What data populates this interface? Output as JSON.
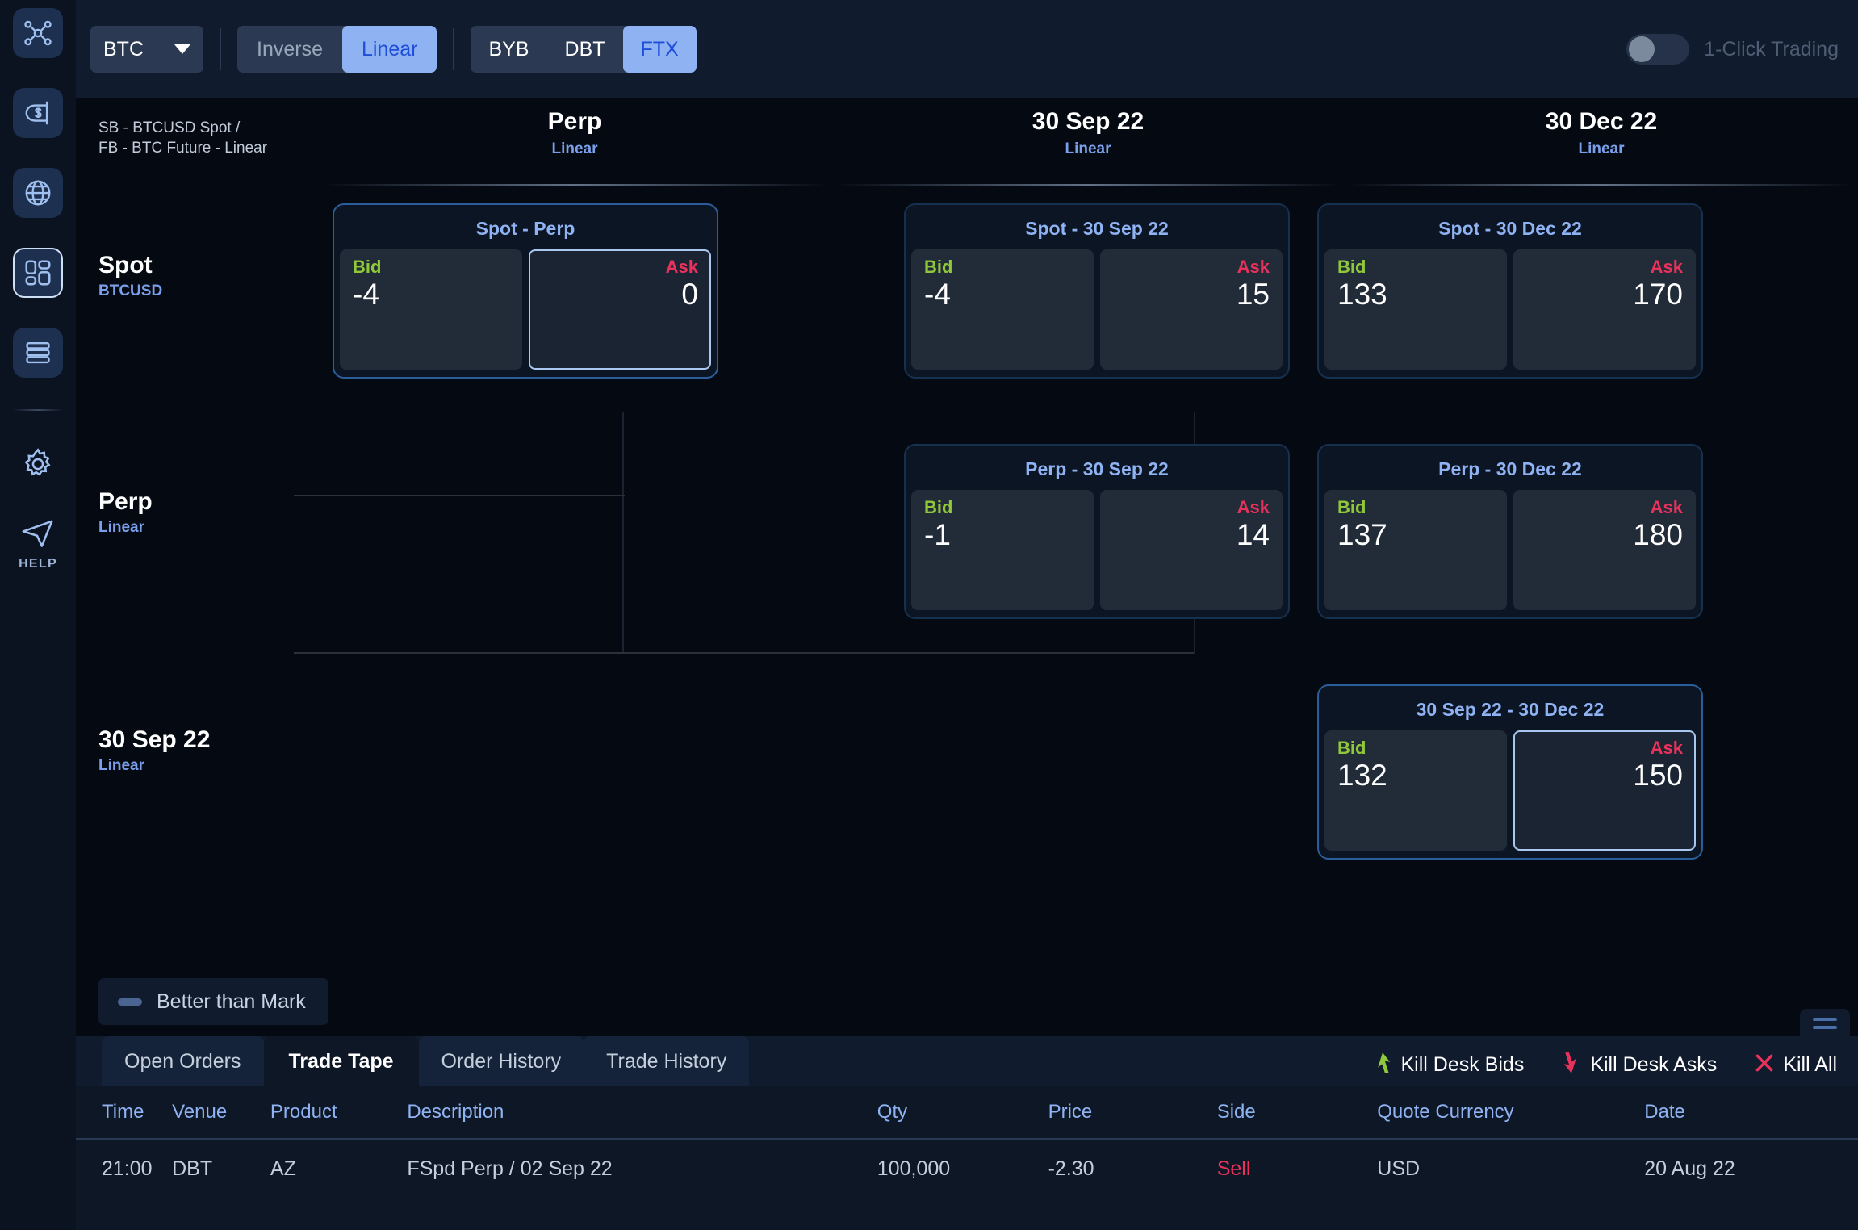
{
  "rail": {
    "items": [
      {
        "name": "network-icon",
        "label": ""
      },
      {
        "name": "dollar-flag-icon",
        "label": ""
      },
      {
        "name": "globe-icon",
        "label": ""
      },
      {
        "name": "dashboard-icon",
        "label": ""
      },
      {
        "name": "list-icon",
        "label": ""
      },
      {
        "name": "gear-icon",
        "label": ""
      },
      {
        "name": "help-icon",
        "label": "HELP"
      }
    ],
    "help_label": "HELP"
  },
  "toolbar": {
    "asset": "BTC",
    "asset_options": [
      "BTC"
    ],
    "contract_types": [
      {
        "label": "Inverse",
        "active": false
      },
      {
        "label": "Linear",
        "active": true
      }
    ],
    "venues": [
      {
        "label": "BYB",
        "active": false
      },
      {
        "label": "DBT",
        "active": false
      },
      {
        "label": "FTX",
        "active": true
      }
    ],
    "one_click_label": "1-Click Trading",
    "one_click_on": false
  },
  "matrix": {
    "corner_line1": "SB - BTCUSD Spot /",
    "corner_line2": "FB - BTC Future - Linear",
    "columns": [
      {
        "title": "Perp",
        "sub": "Linear"
      },
      {
        "title": "30 Sep 22",
        "sub": "Linear"
      },
      {
        "title": "30 Dec 22",
        "sub": "Linear"
      }
    ],
    "rows": [
      {
        "title": "Spot",
        "sub": "BTCUSD"
      },
      {
        "title": "Perp",
        "sub": "Linear"
      },
      {
        "title": "30 Sep 22",
        "sub": "Linear"
      }
    ],
    "bid_label": "Bid",
    "ask_label": "Ask",
    "cards": [
      {
        "row": 0,
        "col": 0,
        "title": "Spot - Perp",
        "bid": "-4",
        "ask": "0",
        "selected": true,
        "bid_highlight": false,
        "ask_highlight": true
      },
      {
        "row": 0,
        "col": 1,
        "title": "Spot - 30 Sep 22",
        "bid": "-4",
        "ask": "15",
        "selected": false,
        "bid_highlight": false,
        "ask_highlight": false
      },
      {
        "row": 0,
        "col": 2,
        "title": "Spot - 30 Dec 22",
        "bid": "133",
        "ask": "170",
        "selected": false,
        "bid_highlight": false,
        "ask_highlight": false
      },
      {
        "row": 1,
        "col": 1,
        "title": "Perp - 30 Sep 22",
        "bid": "-1",
        "ask": "14",
        "selected": false,
        "bid_highlight": false,
        "ask_highlight": false
      },
      {
        "row": 1,
        "col": 2,
        "title": "Perp - 30 Dec 22",
        "bid": "137",
        "ask": "180",
        "selected": false,
        "bid_highlight": false,
        "ask_highlight": false
      },
      {
        "row": 2,
        "col": 2,
        "title": "30 Sep 22 - 30 Dec 22",
        "bid": "132",
        "ask": "150",
        "selected": true,
        "bid_highlight": false,
        "ask_highlight": true
      }
    ],
    "legend_label": "Better than Mark"
  },
  "bottom": {
    "tabs": [
      {
        "label": "Open Orders",
        "active": false
      },
      {
        "label": "Trade Tape",
        "active": true
      },
      {
        "label": "Order History",
        "active": false
      },
      {
        "label": "Trade History",
        "active": false
      }
    ],
    "actions": [
      {
        "label": "Kill Desk Bids",
        "icon": "arrow-up-icon",
        "color": "#8fc93a"
      },
      {
        "label": "Kill Desk Asks",
        "icon": "arrow-down-icon",
        "color": "#e8325c"
      },
      {
        "label": "Kill All",
        "icon": "close-x-icon",
        "color": "#e8325c"
      }
    ],
    "table": {
      "headers": [
        "Time",
        "Venue",
        "Product",
        "Description",
        "Qty",
        "Price",
        "Side",
        "Quote Currency",
        "Date"
      ],
      "rows": [
        {
          "time": "21:00",
          "venue": "DBT",
          "product": "AZ",
          "description": "FSpd Perp / 02 Sep 22",
          "qty": "100,000",
          "price": "-2.30",
          "side": "Sell",
          "quote_currency": "USD",
          "date": "20 Aug 22"
        }
      ]
    }
  },
  "colors": {
    "accent_blue": "#8fb2f2",
    "bid_green": "#8fc93a",
    "ask_red": "#e8325c",
    "panel": "#101b2e",
    "background": "#050a12"
  }
}
